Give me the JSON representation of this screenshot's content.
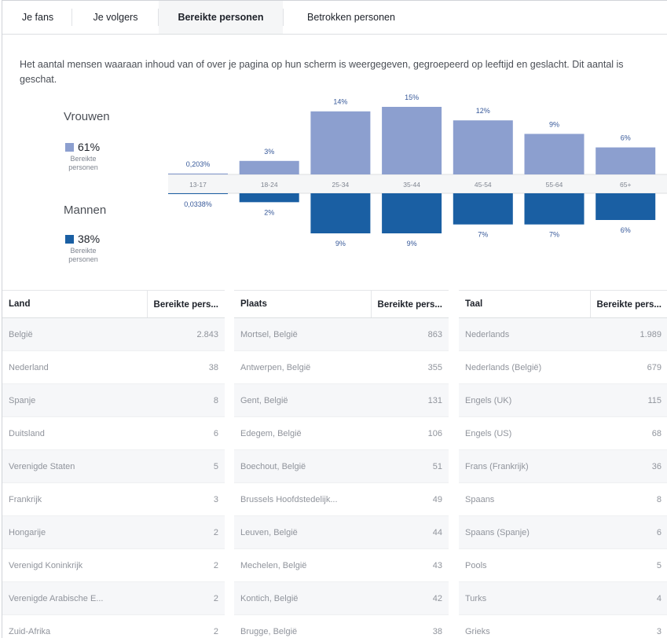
{
  "tabs": [
    "Je fans",
    "Je volgers",
    "Bereikte personen",
    "Betrokken personen"
  ],
  "active_tab": "Bereikte personen",
  "description": "Het aantal mensen waaraan inhoud van of over je pagina op hun scherm is weergegeven, gegroepeerd op leeftijd en geslacht. Dit aantal is geschat.",
  "legend": {
    "women": {
      "title": "Vrouwen",
      "pct": "61%",
      "sub": "Bereikte personen",
      "color": "#8c9fcf"
    },
    "men": {
      "title": "Mannen",
      "pct": "38%",
      "sub": "Bereikte personen",
      "color": "#1a5fa3"
    }
  },
  "chart_data": {
    "type": "bar",
    "categories": [
      "13-17",
      "18-24",
      "25-34",
      "35-44",
      "45-54",
      "55-64",
      "65+"
    ],
    "series": [
      {
        "name": "Vrouwen",
        "values": [
          0.203,
          3,
          14,
          15,
          12,
          9,
          6
        ],
        "labels": [
          "0,203%",
          "3%",
          "14%",
          "15%",
          "12%",
          "9%",
          "6%"
        ],
        "color": "#8c9fcf"
      },
      {
        "name": "Mannen",
        "values": [
          0.0338,
          2,
          9,
          9,
          7,
          7,
          6
        ],
        "labels": [
          "0,0338%",
          "2%",
          "9%",
          "9%",
          "7%",
          "7%",
          "6%"
        ],
        "color": "#1a5fa3"
      }
    ],
    "title": "",
    "xlabel": "",
    "ylabel": ""
  },
  "tables": [
    {
      "headers": [
        "Land",
        "Bereikte pers..."
      ],
      "rows": [
        [
          "België",
          "2.843"
        ],
        [
          "Nederland",
          "38"
        ],
        [
          "Spanje",
          "8"
        ],
        [
          "Duitsland",
          "6"
        ],
        [
          "Verenigde Staten",
          "5"
        ],
        [
          "Frankrijk",
          "3"
        ],
        [
          "Hongarije",
          "2"
        ],
        [
          "Verenigd Koninkrijk",
          "2"
        ],
        [
          "Verenigde Arabische E...",
          "2"
        ],
        [
          "Zuid-Afrika",
          "2"
        ]
      ]
    },
    {
      "headers": [
        "Plaats",
        "Bereikte pers..."
      ],
      "rows": [
        [
          "Mortsel, België",
          "863"
        ],
        [
          "Antwerpen, België",
          "355"
        ],
        [
          "Gent, België",
          "131"
        ],
        [
          "Edegem, België",
          "106"
        ],
        [
          "Boechout, België",
          "51"
        ],
        [
          "Brussels Hoofdstedelijk...",
          "49"
        ],
        [
          "Leuven, België",
          "44"
        ],
        [
          "Mechelen, België",
          "43"
        ],
        [
          "Kontich, België",
          "42"
        ],
        [
          "Brugge, België",
          "38"
        ]
      ]
    },
    {
      "headers": [
        "Taal",
        "Bereikte pers..."
      ],
      "rows": [
        [
          "Nederlands",
          "1.989"
        ],
        [
          "Nederlands (België)",
          "679"
        ],
        [
          "Engels (UK)",
          "115"
        ],
        [
          "Engels (US)",
          "68"
        ],
        [
          "Frans (Frankrijk)",
          "36"
        ],
        [
          "Spaans",
          "8"
        ],
        [
          "Spaans (Spanje)",
          "6"
        ],
        [
          "Pools",
          "5"
        ],
        [
          "Turks",
          "4"
        ],
        [
          "Grieks",
          "3"
        ]
      ]
    }
  ]
}
